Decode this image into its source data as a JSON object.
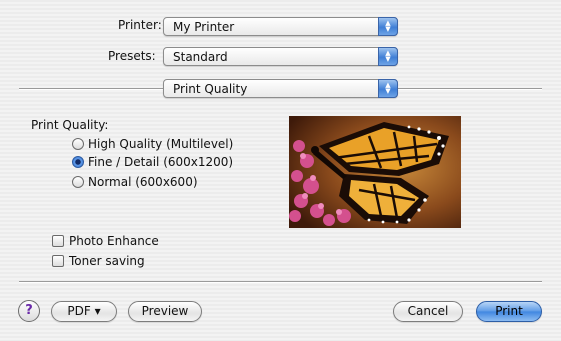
{
  "printer": {
    "label": "Printer:",
    "value": "My Printer"
  },
  "presets": {
    "label": "Presets:",
    "value": "Standard"
  },
  "panel": {
    "value": "Print Quality"
  },
  "print_quality": {
    "heading": "Print Quality:",
    "options": [
      {
        "label": "High Quality (Multilevel)",
        "selected": false
      },
      {
        "label": "Fine / Detail (600x1200)",
        "selected": true
      },
      {
        "label": "Normal (600x600)",
        "selected": false
      }
    ]
  },
  "checkboxes": [
    {
      "label": "Photo Enhance",
      "checked": false
    },
    {
      "label": "Toner saving",
      "checked": false
    }
  ],
  "footer": {
    "help": "?",
    "pdf": "PDF ▾",
    "preview": "Preview",
    "cancel": "Cancel",
    "print": "Print"
  },
  "colors": {
    "accent": "#3f86e0"
  },
  "icons": {
    "popup": "up-down-arrows-icon",
    "help": "question-mark-icon"
  }
}
